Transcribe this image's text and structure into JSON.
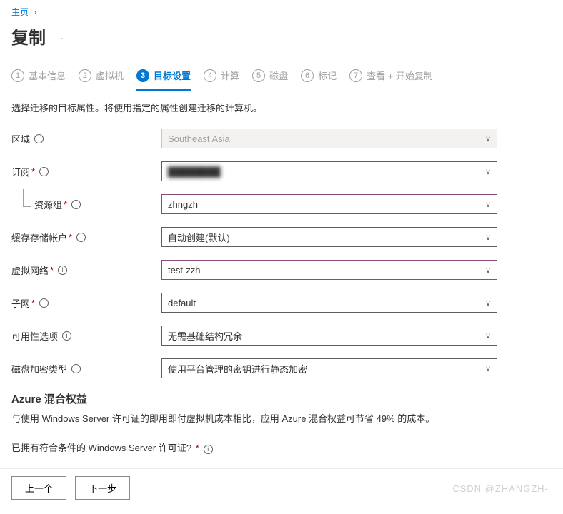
{
  "breadcrumb": {
    "home": "主页"
  },
  "page": {
    "title": "复制",
    "more": "…"
  },
  "wizard": [
    {
      "num": "1",
      "label": "基本信息"
    },
    {
      "num": "2",
      "label": "虚拟机"
    },
    {
      "num": "3",
      "label": "目标设置"
    },
    {
      "num": "4",
      "label": "计算"
    },
    {
      "num": "5",
      "label": "磁盘"
    },
    {
      "num": "6",
      "label": "标记"
    },
    {
      "num": "7",
      "label": "查看 + 开始复制"
    }
  ],
  "description": "选择迁移的目标属性。将使用指定的属性创建迁移的计算机。",
  "fields": {
    "region": {
      "label": "区域",
      "value": "Southeast Asia"
    },
    "subscription": {
      "label": "订阅",
      "value": "████████"
    },
    "resourceGroup": {
      "label": "资源组",
      "value": "zhngzh"
    },
    "cacheStorage": {
      "label": "缓存存储帐户",
      "value": "自动创建(默认)"
    },
    "vnet": {
      "label": "虚拟网络",
      "value": "test-zzh"
    },
    "subnet": {
      "label": "子网",
      "value": "default"
    },
    "availability": {
      "label": "可用性选项",
      "value": "无需基础结构冗余"
    },
    "diskEncryption": {
      "label": "磁盘加密类型",
      "value": "使用平台管理的密钥进行静态加密"
    }
  },
  "hybrid": {
    "title": "Azure 混合权益",
    "desc": "与使用 Windows Server 许可证的即用即付虚拟机成本相比，应用 Azure 混合权益可节省 49% 的成本。",
    "question": "已拥有符合条件的 Windows Server 许可证? "
  },
  "footer": {
    "prev": "上一个",
    "next": "下一步"
  },
  "watermark": "CSDN @ZHANGZH-"
}
